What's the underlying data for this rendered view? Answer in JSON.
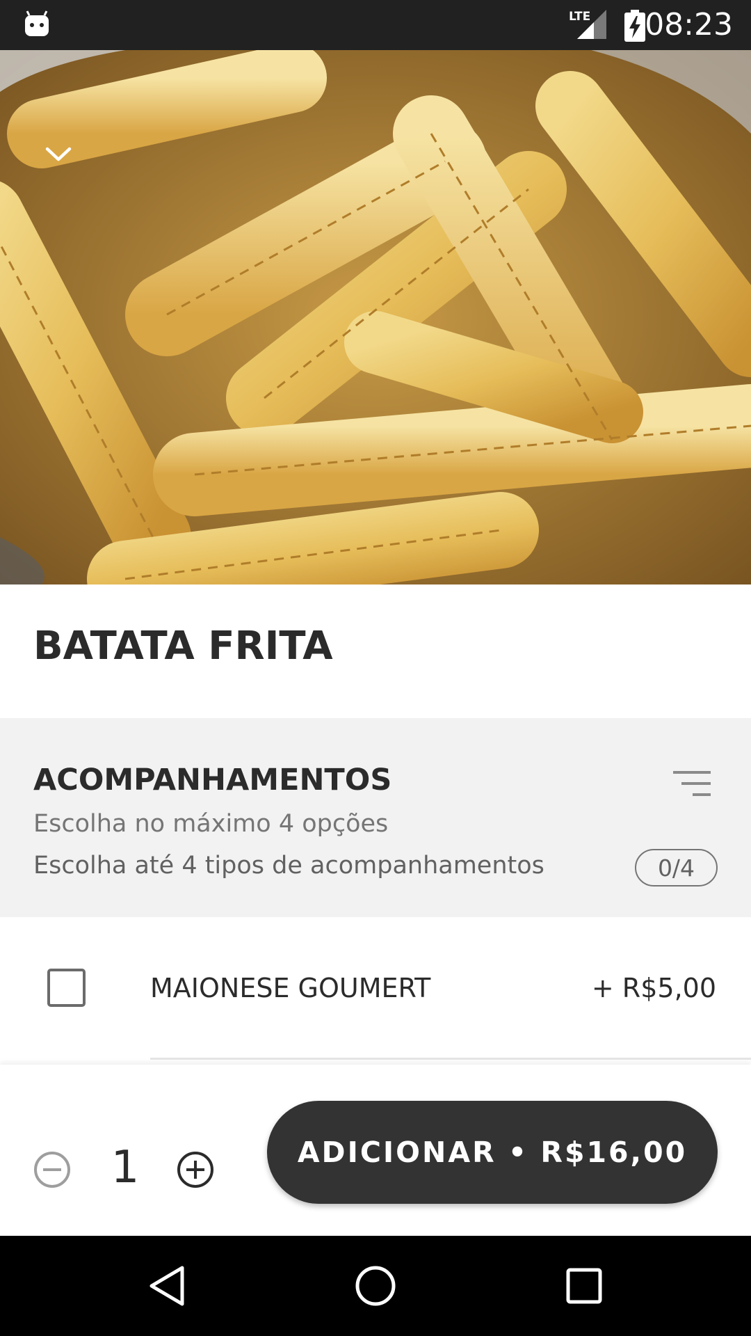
{
  "status_bar": {
    "time": "08:23",
    "network": "LTE",
    "icons": [
      "android-app-icon",
      "lte-signal-icon",
      "battery-charging-icon"
    ]
  },
  "hero": {
    "image": "batata-frita-photo",
    "collapse_icon": "chevron-down-icon"
  },
  "product": {
    "title": "BATATA FRITA"
  },
  "section": {
    "title": "ACOMPANHAMENTOS",
    "subtitle": "Escolha no máximo 4 opções",
    "description": "Escolha até 4 tipos de acompanhamentos",
    "counter": "0/4",
    "sort_icon": "sort-lines-icon"
  },
  "options": [
    {
      "label": "MAIONESE GOUMERT",
      "price": "+ R$5,00",
      "checked": false
    }
  ],
  "order": {
    "quantity": "1",
    "add_label": "ADICIONAR • R$16,00",
    "minus_icon": "minus-circle-icon",
    "plus_icon": "plus-circle-icon"
  },
  "nav": {
    "buttons": [
      "back-triangle-icon",
      "home-circle-icon",
      "recents-square-icon"
    ]
  },
  "colors": {
    "status_bar": "#212121",
    "section_bg": "#f2f2f2",
    "button_bg": "#333333",
    "nav_bar": "#000000"
  }
}
